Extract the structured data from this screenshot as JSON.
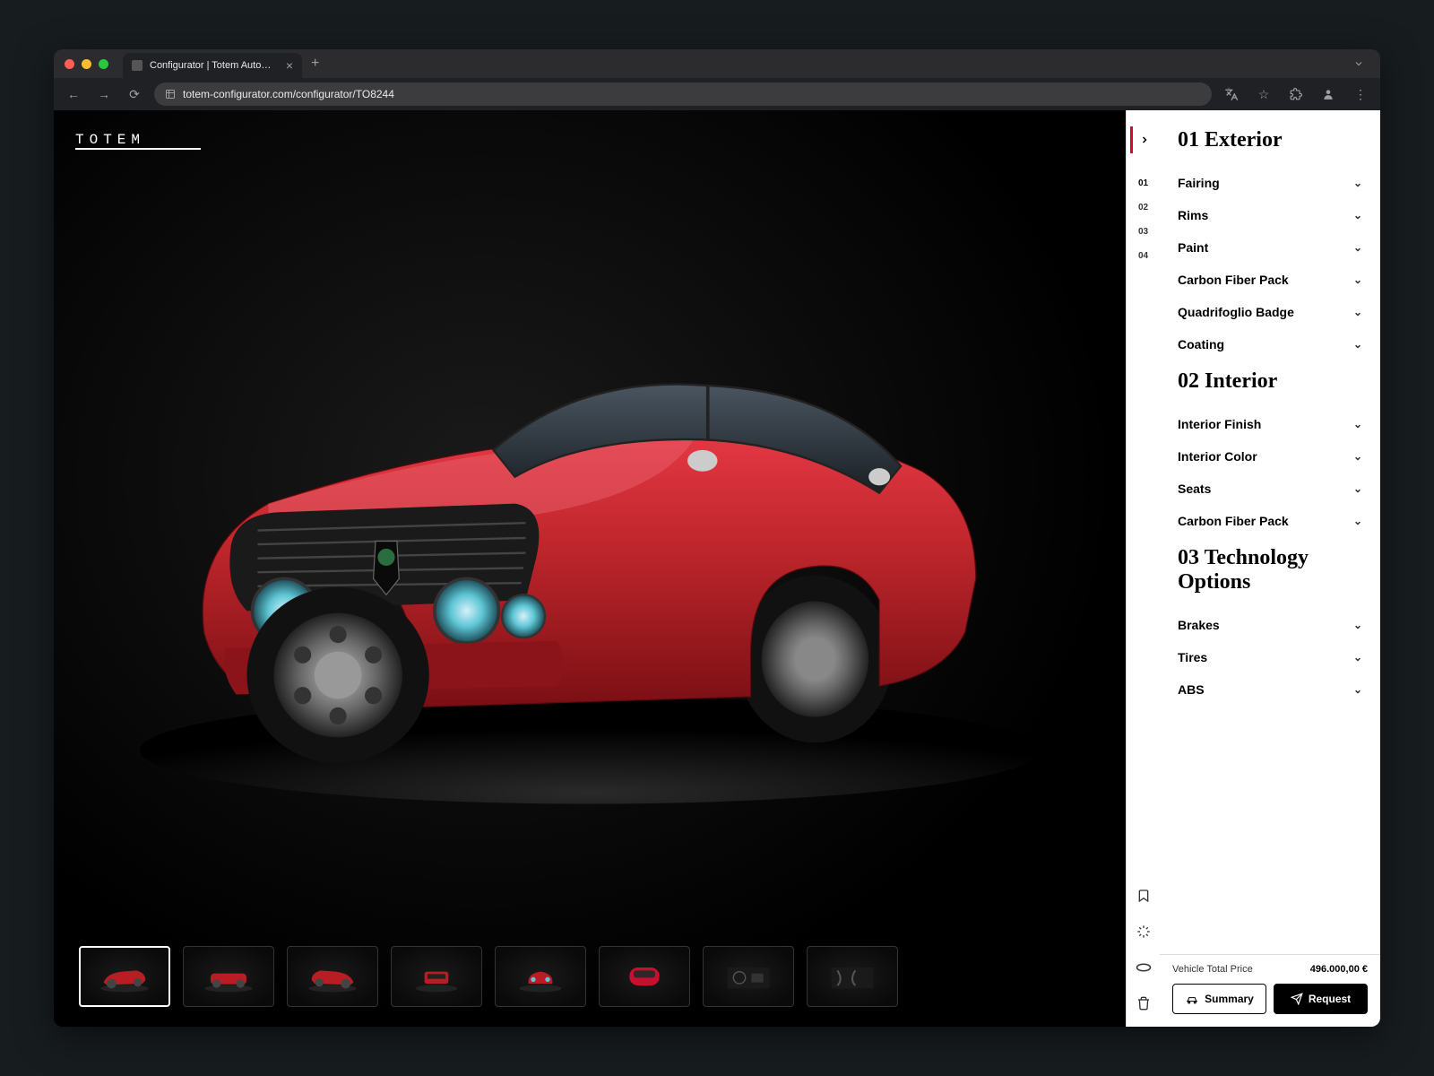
{
  "browser": {
    "tab_title": "Configurator | Totem Automo…",
    "url": "totem-configurator.com/configurator/TO8244"
  },
  "brand": {
    "logo_text": "TOTEM"
  },
  "rail": {
    "items": [
      "01",
      "02",
      "03",
      "04"
    ]
  },
  "sections": [
    {
      "title": "01 Exterior",
      "options": [
        "Fairing",
        "Rims",
        "Paint",
        "Carbon Fiber Pack",
        "Quadrifoglio Badge",
        "Coating"
      ]
    },
    {
      "title": "02 Interior",
      "options": [
        "Interior Finish",
        "Interior Color",
        "Seats",
        "Carbon Fiber Pack"
      ]
    },
    {
      "title": "03 Technology Options",
      "options": [
        "Brakes",
        "Tires",
        "ABS"
      ]
    }
  ],
  "footer": {
    "price_label": "Vehicle Total Price",
    "price_value": "496.000,00 €",
    "summary_label": "Summary",
    "request_label": "Request"
  },
  "thumbnails_count": 8,
  "colors": {
    "accent": "#c8102e",
    "car_body": "#b81d24"
  }
}
